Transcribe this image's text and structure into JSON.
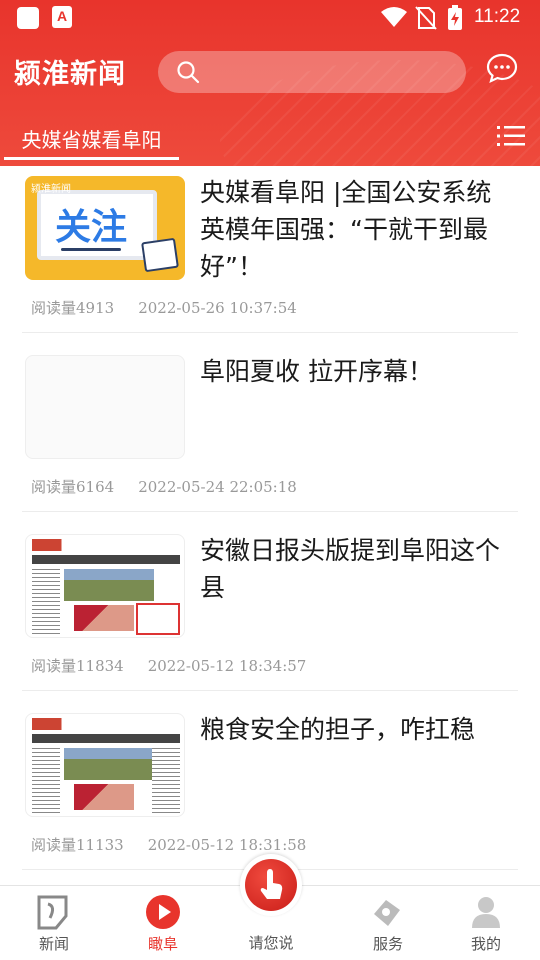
{
  "status_bar": {
    "time": "11:22",
    "icons": [
      "app-square-icon",
      "app-a-icon",
      "wifi-icon",
      "no-sim-icon",
      "battery-charging-icon"
    ]
  },
  "header": {
    "logo_text": "颍淮新闻",
    "search_placeholder": "",
    "active_tab": "央媒省媒看阜阳",
    "brand_color": "#e8342c"
  },
  "news": [
    {
      "title": "央媒看阜阳 |全国公安系统英模年国强：“干就干到最好”！",
      "reads": "阅读量4913",
      "time": "2022-05-26  10:37:54",
      "thumb": "guanzhu",
      "thumb_text": "关注",
      "thumb_brand": "颍淮新闻"
    },
    {
      "title": "阜阳夏收 拉开序幕！",
      "reads": "阅读量6164",
      "time": "2022-05-24  22:05:18",
      "thumb": "blank"
    },
    {
      "title": "安徽日报头版提到阜阳这个县",
      "reads": "阅读量11834",
      "time": "2022-05-12  18:34:57",
      "thumb": "newspaper"
    },
    {
      "title": "粮食安全的担子，咋扛稳",
      "reads": "阅读量11133",
      "time": "2022-05-12  18:31:58",
      "thumb": "newspaper"
    }
  ],
  "bottom_nav": [
    {
      "label": "新闻",
      "icon": "news-icon",
      "active": false
    },
    {
      "label": "瞰阜",
      "icon": "play-icon",
      "active": true
    },
    {
      "label": "请您说",
      "icon": "tap-hand-icon",
      "active": false
    },
    {
      "label": "服务",
      "icon": "service-icon",
      "active": false
    },
    {
      "label": "我的",
      "icon": "user-icon",
      "active": false
    }
  ]
}
